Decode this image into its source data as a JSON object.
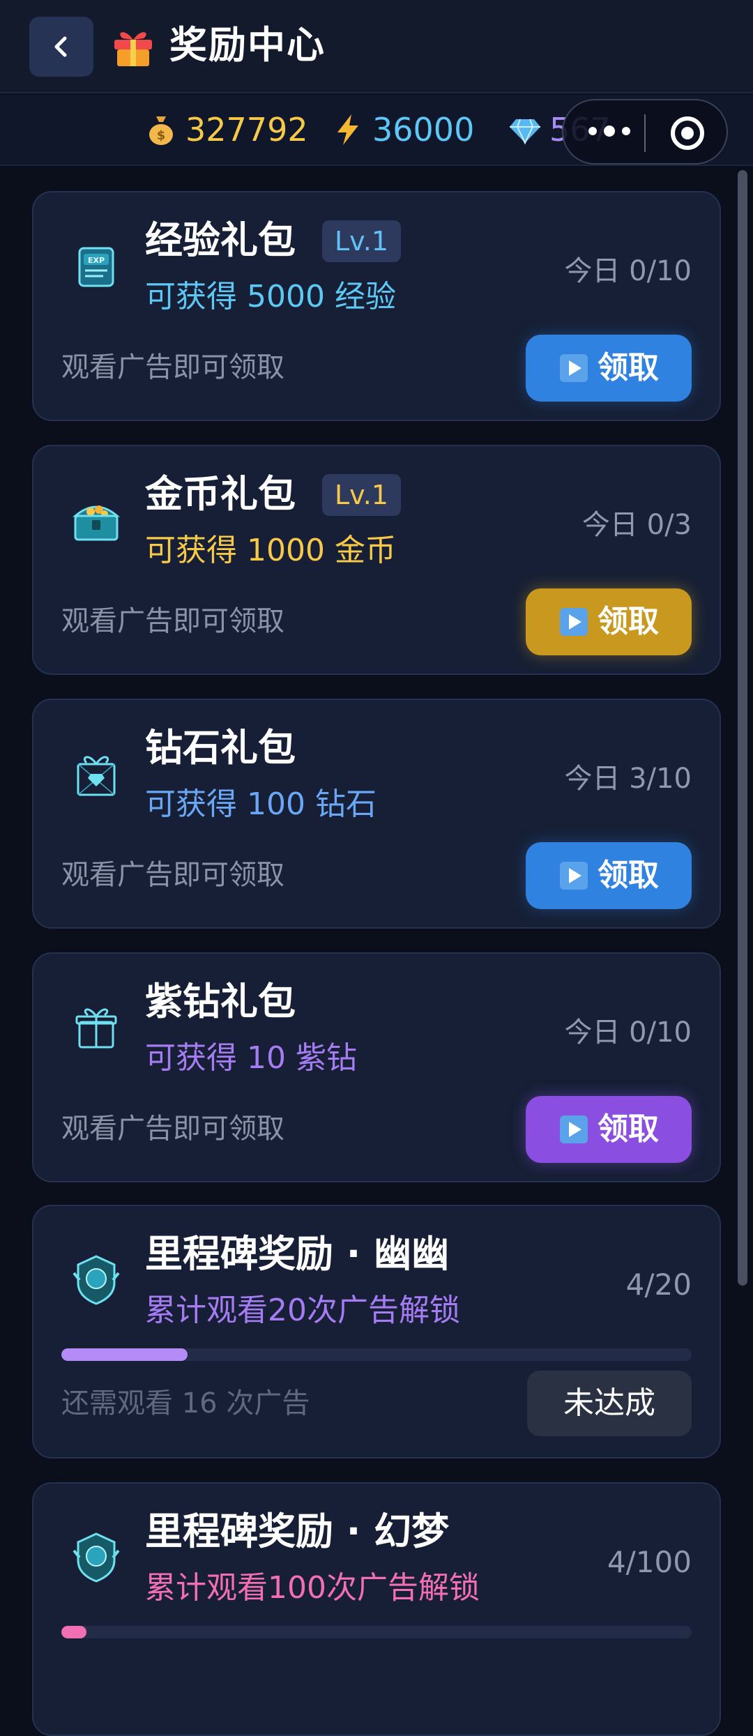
{
  "header": {
    "title": "奖励中心"
  },
  "stats": {
    "gold": "327792",
    "energy": "36000",
    "diamond": "567"
  },
  "cards": [
    {
      "name": "经验礼包",
      "level": "Lv.1",
      "reward": "可获得 5000 经验",
      "today": "今日 0/10",
      "hint": "观看广告即可领取",
      "button": "领取",
      "accent": "#5cc8f3",
      "button_color": "#2f82e0",
      "icon": "exp-book-icon"
    },
    {
      "name": "金币礼包",
      "level": "Lv.1",
      "reward": "可获得 1000 金币",
      "today": "今日 0/3",
      "hint": "观看广告即可领取",
      "button": "领取",
      "accent": "#f7c948",
      "button_color": "#c8991e",
      "icon": "treasure-chest-icon"
    },
    {
      "name": "钻石礼包",
      "reward": "可获得 100 钻石",
      "today": "今日 3/10",
      "hint": "观看广告即可领取",
      "button": "领取",
      "accent": "#6aa8f5",
      "button_color": "#2f82e0",
      "icon": "diamond-gift-icon"
    },
    {
      "name": "紫钻礼包",
      "reward": "可获得 10 紫钻",
      "today": "今日 0/10",
      "hint": "观看广告即可领取",
      "button": "领取",
      "accent": "#a67cf3",
      "button_color": "#8a4fe0",
      "icon": "purple-gift-icon"
    }
  ],
  "milestones": [
    {
      "name": "里程碑奖励 · 幽幽",
      "requirement": "累计观看20次广告解锁",
      "count": "4/20",
      "progress": 0.2,
      "remaining": "还需观看 16 次广告",
      "status": "未达成",
      "accent": "#a67cf3",
      "bar_color": "#b58cf7",
      "icon": "milestone-badge-icon"
    },
    {
      "name": "里程碑奖励 · 幻梦",
      "requirement": "累计观看100次广告解锁",
      "count": "4/100",
      "progress": 0.04,
      "accent": "#f26fb3",
      "bar_color": "#f26fb3",
      "icon": "milestone-badge-icon"
    }
  ]
}
